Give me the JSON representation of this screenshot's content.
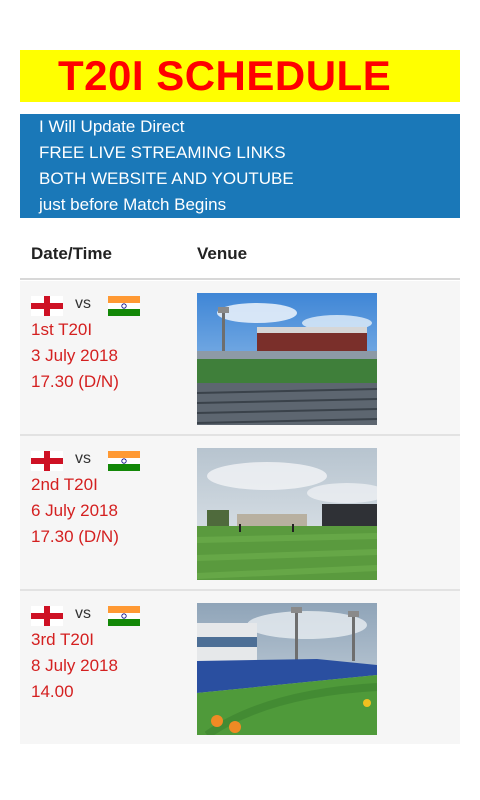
{
  "banner": {
    "title": "T20I SCHEDULE"
  },
  "info": {
    "lines": [
      "I Will Update Direct",
      "FREE LIVE STREAMING LINKS",
      "BOTH WEBSITE AND YOUTUBE",
      "just before Match Begins"
    ]
  },
  "table": {
    "headers": {
      "datetime": "Date/Time",
      "venue": "Venue"
    },
    "rows": [
      {
        "vs": "vs",
        "match": "1st T20I",
        "date": "3 July 2018",
        "time": "17.30 (D/N)",
        "home_flag": "england-flag",
        "away_flag": "india-flag"
      },
      {
        "vs": "vs",
        "match": "2nd T20I",
        "date": "6 July 2018",
        "time": "17.30 (D/N)",
        "home_flag": "england-flag",
        "away_flag": "india-flag"
      },
      {
        "vs": "vs",
        "match": "3rd T20I",
        "date": "8 July 2018",
        "time": "14.00",
        "home_flag": "england-flag",
        "away_flag": "india-flag"
      }
    ]
  },
  "colors": {
    "banner_bg": "#ffff00",
    "banner_text": "#ff0000",
    "info_bg": "#1a78b8",
    "row_text": "#d42020"
  }
}
